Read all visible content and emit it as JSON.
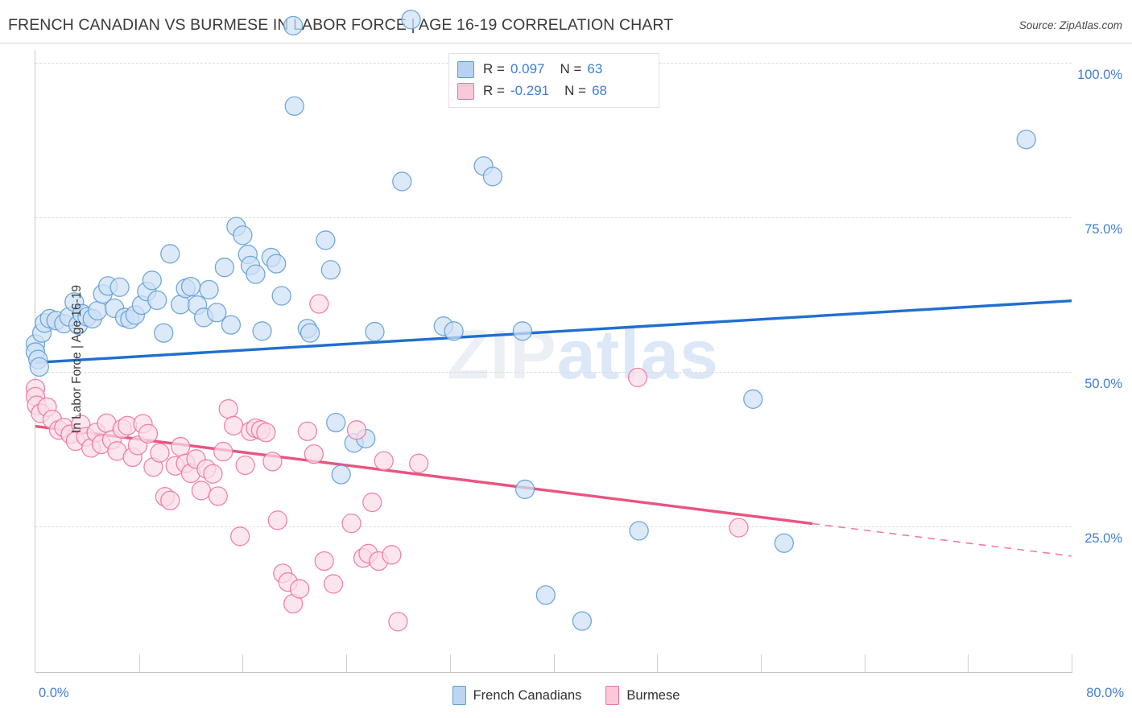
{
  "header": {
    "title": "FRENCH CANADIAN VS BURMESE IN LABOR FORCE | AGE 16-19 CORRELATION CHART",
    "source": "Source: ZipAtlas.com"
  },
  "watermark": {
    "part1": "ZIP",
    "part2": "atlas"
  },
  "stats": {
    "blue": {
      "r_label": "R =",
      "r_value": "0.097",
      "n_label": "N =",
      "n_value": "63"
    },
    "pink": {
      "r_label": "R =",
      "r_value": "-0.291",
      "n_label": "N =",
      "n_value": "68"
    }
  },
  "legend": {
    "items": [
      {
        "label": "French Canadians",
        "color": "#bcd6f2"
      },
      {
        "label": "Burmese",
        "color": "#fbc8d8"
      }
    ]
  },
  "axes": {
    "y_title": "In Labor Force | Age 16-19",
    "y_ticks": [
      "100.0%",
      "75.0%",
      "50.0%",
      "25.0%"
    ],
    "x_min_label": "0.0%",
    "x_max_label": "80.0%"
  },
  "chart_data": {
    "type": "scatter",
    "title": "FRENCH CANADIAN VS BURMESE IN LABOR FORCE | AGE 16-19 CORRELATION CHART",
    "xlabel": "",
    "ylabel": "In Labor Force | Age 16-19",
    "xlim": [
      0,
      80
    ],
    "ylim": [
      0,
      107.3
    ],
    "x_ticks": [
      0,
      8,
      16,
      24,
      32,
      40,
      48,
      56,
      64,
      72,
      80
    ],
    "y_ticks": [
      25,
      50,
      75,
      100
    ],
    "grid": "horizontal-dashed",
    "legend_position": "bottom-center",
    "colors": {
      "blue_fill": "#cfe1f7",
      "blue_stroke": "#5b9bd5",
      "pink_fill": "#fbdce7",
      "pink_stroke": "#ef6f9a",
      "blue_line": "#1f6fd0",
      "pink_line": "#e8557f",
      "tick_text": "#3f7fd4"
    },
    "series": [
      {
        "name": "French Canadians",
        "r": 0.097,
        "n": 63,
        "marker_color": "#cfe1f7",
        "marker_stroke": "#5b9bd5",
        "trend": {
          "color": "#1f6fd0",
          "x0": 0,
          "y0": 51.5,
          "x1": 80,
          "y1": 61.5,
          "dashed_from": null
        },
        "points": [
          [
            0.0,
            54.5
          ],
          [
            0.0,
            53.2
          ],
          [
            0.2,
            52.0
          ],
          [
            0.3,
            50.8
          ],
          [
            0.5,
            56.3
          ],
          [
            0.7,
            57.9
          ],
          [
            1.1,
            58.6
          ],
          [
            1.6,
            58.3
          ],
          [
            2.2,
            57.8
          ],
          [
            2.6,
            58.9
          ],
          [
            3.0,
            61.3
          ],
          [
            3.3,
            57.6
          ],
          [
            3.6,
            59.4
          ],
          [
            4.0,
            58.9
          ],
          [
            4.4,
            58.6
          ],
          [
            4.8,
            59.9
          ],
          [
            5.2,
            62.6
          ],
          [
            5.6,
            63.9
          ],
          [
            6.1,
            60.3
          ],
          [
            6.5,
            63.7
          ],
          [
            6.9,
            58.8
          ],
          [
            7.3,
            58.5
          ],
          [
            7.7,
            59.2
          ],
          [
            8.2,
            60.8
          ],
          [
            8.6,
            63.0
          ],
          [
            9.0,
            64.8
          ],
          [
            9.4,
            61.6
          ],
          [
            9.9,
            56.3
          ],
          [
            10.4,
            69.1
          ],
          [
            11.2,
            60.9
          ],
          [
            11.6,
            63.5
          ],
          [
            12.0,
            63.8
          ],
          [
            12.5,
            60.8
          ],
          [
            13.0,
            58.8
          ],
          [
            13.4,
            63.3
          ],
          [
            14.0,
            59.6
          ],
          [
            14.6,
            66.9
          ],
          [
            15.1,
            57.6
          ],
          [
            15.5,
            73.5
          ],
          [
            16.0,
            72.1
          ],
          [
            16.4,
            69.0
          ],
          [
            16.6,
            67.2
          ],
          [
            17.0,
            65.8
          ],
          [
            17.5,
            56.6
          ],
          [
            18.2,
            68.5
          ],
          [
            18.6,
            67.5
          ],
          [
            19.0,
            62.3
          ],
          [
            19.9,
            106.0
          ],
          [
            20.0,
            93.0
          ],
          [
            21.0,
            57.0
          ],
          [
            21.2,
            56.3
          ],
          [
            22.4,
            71.3
          ],
          [
            22.8,
            66.5
          ],
          [
            23.2,
            41.8
          ],
          [
            23.6,
            33.4
          ],
          [
            24.6,
            38.5
          ],
          [
            25.5,
            39.2
          ],
          [
            26.2,
            56.5
          ],
          [
            28.3,
            80.8
          ],
          [
            29.0,
            107.0
          ],
          [
            31.5,
            57.4
          ],
          [
            32.3,
            56.6
          ],
          [
            34.6,
            83.3
          ],
          [
            35.3,
            81.6
          ],
          [
            37.6,
            56.6
          ],
          [
            37.8,
            31.0
          ],
          [
            39.4,
            13.9
          ],
          [
            42.2,
            9.7
          ],
          [
            46.6,
            24.3
          ],
          [
            55.4,
            45.6
          ],
          [
            57.8,
            22.3
          ],
          [
            76.5,
            87.6
          ]
        ]
      },
      {
        "name": "Burmese",
        "r": -0.291,
        "n": 68,
        "marker_color": "#fbdce7",
        "marker_stroke": "#ef6f9a",
        "trend": {
          "color": "#e8557f",
          "x0": 0,
          "y0": 41.2,
          "x1": 80,
          "y1": 20.2,
          "dashed_from": 60.0
        },
        "points": [
          [
            0.0,
            47.3
          ],
          [
            0.0,
            46.0
          ],
          [
            0.1,
            44.6
          ],
          [
            0.4,
            43.3
          ],
          [
            0.9,
            44.3
          ],
          [
            1.3,
            42.3
          ],
          [
            1.8,
            40.6
          ],
          [
            2.2,
            41.0
          ],
          [
            2.7,
            39.9
          ],
          [
            3.1,
            38.8
          ],
          [
            3.5,
            41.5
          ],
          [
            3.9,
            39.5
          ],
          [
            4.3,
            37.7
          ],
          [
            4.7,
            40.2
          ],
          [
            5.1,
            38.3
          ],
          [
            5.5,
            41.7
          ],
          [
            5.9,
            39.0
          ],
          [
            6.3,
            37.2
          ],
          [
            6.7,
            40.8
          ],
          [
            7.1,
            41.3
          ],
          [
            7.5,
            36.2
          ],
          [
            7.9,
            38.1
          ],
          [
            8.3,
            41.6
          ],
          [
            8.7,
            40.0
          ],
          [
            9.1,
            34.6
          ],
          [
            9.6,
            36.9
          ],
          [
            10.0,
            29.8
          ],
          [
            10.4,
            29.2
          ],
          [
            10.8,
            34.8
          ],
          [
            11.2,
            37.9
          ],
          [
            11.6,
            35.2
          ],
          [
            12.0,
            33.6
          ],
          [
            12.4,
            35.9
          ],
          [
            12.8,
            30.8
          ],
          [
            13.2,
            34.3
          ],
          [
            13.7,
            33.5
          ],
          [
            14.1,
            29.9
          ],
          [
            14.5,
            37.1
          ],
          [
            14.9,
            44.0
          ],
          [
            15.3,
            41.3
          ],
          [
            15.8,
            23.4
          ],
          [
            16.2,
            34.9
          ],
          [
            16.6,
            40.4
          ],
          [
            17.0,
            40.9
          ],
          [
            17.4,
            40.6
          ],
          [
            17.8,
            40.2
          ],
          [
            18.3,
            35.5
          ],
          [
            18.7,
            26.0
          ],
          [
            19.1,
            17.4
          ],
          [
            19.5,
            16.0
          ],
          [
            19.9,
            12.5
          ],
          [
            20.4,
            14.9
          ],
          [
            21.0,
            40.4
          ],
          [
            21.5,
            36.7
          ],
          [
            21.9,
            61.0
          ],
          [
            22.3,
            19.4
          ],
          [
            23.0,
            15.7
          ],
          [
            24.4,
            25.5
          ],
          [
            24.8,
            40.6
          ],
          [
            25.3,
            19.9
          ],
          [
            25.7,
            20.6
          ],
          [
            26.0,
            28.9
          ],
          [
            26.5,
            19.4
          ],
          [
            26.9,
            35.6
          ],
          [
            27.5,
            20.4
          ],
          [
            28.0,
            9.6
          ],
          [
            29.6,
            35.2
          ],
          [
            46.5,
            49.1
          ],
          [
            54.3,
            24.8
          ]
        ]
      }
    ]
  }
}
